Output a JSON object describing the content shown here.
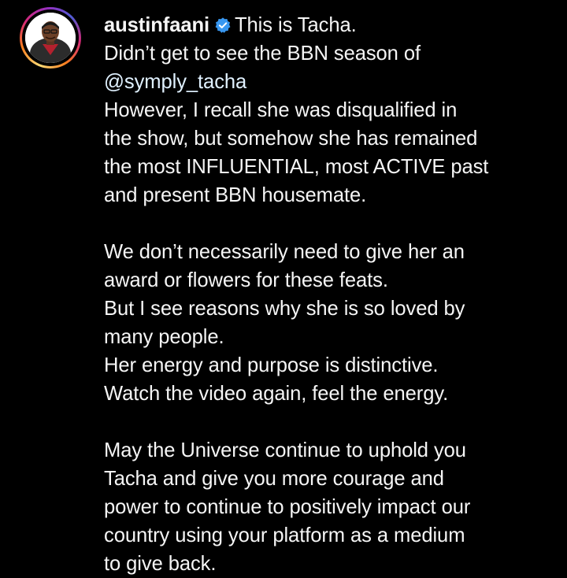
{
  "post": {
    "username": "austinfaani",
    "verified": true,
    "first_line": "This is Tacha.",
    "lines": {
      "l2": "Didn’t get to see the BBN season of",
      "mention": "@symply_tacha",
      "l4": "However, I recall she was disqualified in",
      "l5": "the show, but somehow she has remained",
      "l6": "the most INFLUENTIAL, most ACTIVE past",
      "l7": "and present BBN housemate.",
      "l9": "We don’t necessarily need to give her an",
      "l10": "award or flowers for these feats.",
      "l11": "But I see reasons why she is so loved by",
      "l12": "many people.",
      "l13": "Her energy and purpose is distinctive.",
      "l14": "Watch the video again, feel the energy.",
      "l16": "May the Universe continue to uphold you",
      "l17": "Tacha and give you more courage and",
      "l18": "power to continue to positively impact our",
      "l19": "country using your platform as a medium",
      "l20": "to give back."
    }
  },
  "colors": {
    "background": "#000000",
    "text": "#f5f5f5",
    "mention": "#e0f1ff",
    "verified_badge": "#3897f0"
  },
  "icons": {
    "verified": "verified-badge-icon",
    "avatar": "profile-avatar"
  }
}
